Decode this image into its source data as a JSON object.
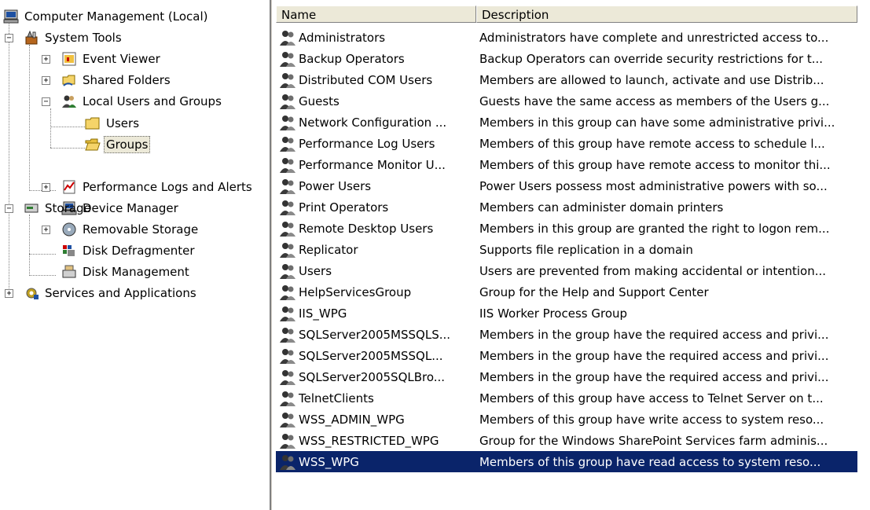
{
  "tree": {
    "root": "Computer Management (Local)",
    "system_tools": "System Tools",
    "event_viewer": "Event Viewer",
    "shared_folders": "Shared Folders",
    "local_users_groups": "Local Users and Groups",
    "users": "Users",
    "groups": "Groups",
    "perf_logs": "Performance Logs and Alerts",
    "device_manager": "Device Manager",
    "storage": "Storage",
    "removable_storage": "Removable Storage",
    "disk_defrag": "Disk Defragmenter",
    "disk_management": "Disk Management",
    "services_apps": "Services and Applications"
  },
  "list": {
    "headers": {
      "name": "Name",
      "description": "Description"
    },
    "rows": [
      {
        "name": "Administrators",
        "description": "Administrators have complete and unrestricted access to..."
      },
      {
        "name": "Backup Operators",
        "description": "Backup Operators can override security restrictions for t..."
      },
      {
        "name": "Distributed COM Users",
        "description": "Members are allowed to launch, activate and use Distrib..."
      },
      {
        "name": "Guests",
        "description": "Guests have the same access as members of the Users g..."
      },
      {
        "name": "Network Configuration ...",
        "description": "Members in this group can have some administrative privi..."
      },
      {
        "name": "Performance Log Users",
        "description": "Members of this group have remote access to schedule l..."
      },
      {
        "name": "Performance Monitor U...",
        "description": "Members of this group have remote access to monitor thi..."
      },
      {
        "name": "Power Users",
        "description": "Power Users possess most administrative powers with so..."
      },
      {
        "name": "Print Operators",
        "description": "Members can administer domain printers"
      },
      {
        "name": "Remote Desktop Users",
        "description": "Members in this group are granted the right to logon rem..."
      },
      {
        "name": "Replicator",
        "description": "Supports file replication in a domain"
      },
      {
        "name": "Users",
        "description": "Users are prevented from making accidental or intention..."
      },
      {
        "name": "HelpServicesGroup",
        "description": "Group for the Help and Support Center"
      },
      {
        "name": "IIS_WPG",
        "description": "IIS Worker Process Group"
      },
      {
        "name": "SQLServer2005MSSQLS...",
        "description": "Members in the group have the required access and privi..."
      },
      {
        "name": "SQLServer2005MSSQL...",
        "description": "Members in the group have the required access and privi..."
      },
      {
        "name": "SQLServer2005SQLBro...",
        "description": "Members in the group have the required access and privi..."
      },
      {
        "name": "TelnetClients",
        "description": "Members of this group have access to Telnet Server on t..."
      },
      {
        "name": "WSS_ADMIN_WPG",
        "description": "Members of this group have write access to system reso..."
      },
      {
        "name": "WSS_RESTRICTED_WPG",
        "description": "Group for the Windows SharePoint Services farm adminis..."
      },
      {
        "name": "WSS_WPG",
        "description": "Members of this group have read access to system reso..."
      }
    ],
    "selected_row": "WSS_WPG"
  },
  "colors": {
    "selection": "#0a246a",
    "header": "#ece9d8"
  }
}
